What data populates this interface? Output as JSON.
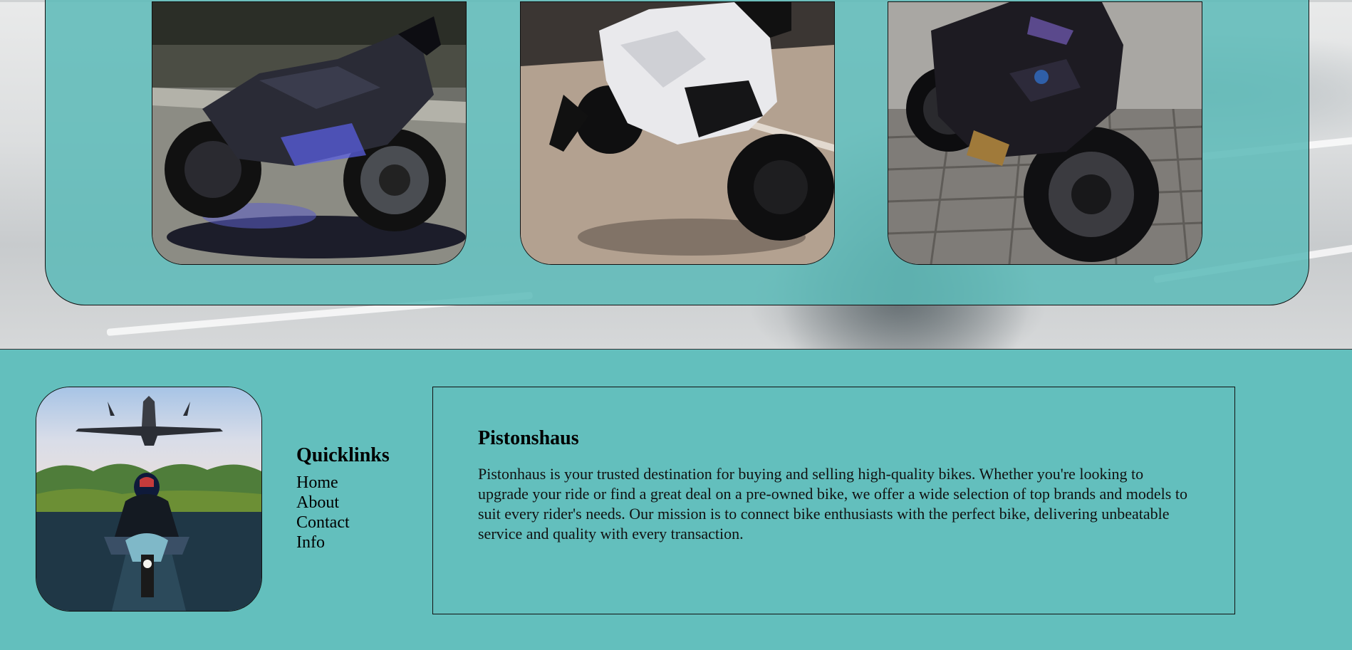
{
  "gallery": {
    "images": [
      {
        "name": "black-sportbike-blue-underglow",
        "alt": "Black sport bike with blue underglow"
      },
      {
        "name": "white-sportbike-on-stand",
        "alt": "White sport bike on a paddock stand"
      },
      {
        "name": "black-bmw-sportbike",
        "alt": "Black BMW sport bike on paving stones"
      }
    ]
  },
  "footer": {
    "photo_alt": "Rider on a motorcycle with a fighter jet overhead",
    "quicklinks": {
      "title": "Quicklinks",
      "links": [
        "Home",
        "About",
        "Contact",
        "Info"
      ]
    },
    "about": {
      "title": "Pistonshaus",
      "text": "Pistonhaus is your trusted destination for buying and selling high-quality bikes. Whether you're looking to upgrade your ride or find a great deal on a pre-owned bike, we offer a wide selection of top brands and models to suit every rider's needs. Our mission is to connect bike enthusiasts with the perfect bike, delivering unbeatable service and quality with every transaction."
    }
  },
  "colors": {
    "teal": "#63bfbd",
    "showcase_teal": "#5cbab8"
  }
}
